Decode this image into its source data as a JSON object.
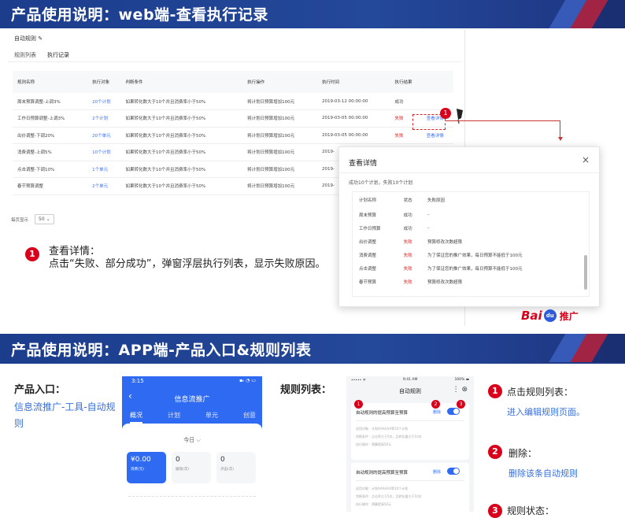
{
  "banner1": {
    "title": "产品使用说明：web端-查看执行记录"
  },
  "banner2": {
    "title": "产品使用说明：APP端-产品入口&规则列表"
  },
  "web": {
    "card_title": "自动规则",
    "tabs": [
      "规则列表",
      "执行记录"
    ],
    "columns": [
      "规则名称",
      "执行对象",
      "判断条件",
      "执行操作",
      "执行时间",
      "执行结果"
    ],
    "rows": [
      {
        "name": "周末预算调整-上调3%",
        "target": "20个计划",
        "cond": "如果转化数大于10个并且消费率小于50%",
        "op": "将计划日预算增加100元",
        "time": "2019-03-12 00:00:00",
        "result": "成功",
        "link": ""
      },
      {
        "name": "工作日预算调整-上调3%",
        "target": "2个计划",
        "cond": "如果转化数大于10个并且消费率小于50%",
        "op": "将计划日预算增加100元",
        "time": "2019-03-05 00:00:00",
        "result": "失败",
        "link": "查看详情"
      },
      {
        "name": "出价调整-下调20%",
        "target": "20个单元",
        "cond": "如果转化数大于10个并且消费率小于50%",
        "op": "将计划日预算增加100元",
        "time": "2019-03-05 00:00:00",
        "result": "失败",
        "link": "查看详情"
      },
      {
        "name": "消费调整-上调5%",
        "target": "10个计划",
        "cond": "如果转化数大于10个并且消费率小于50%",
        "op": "将计划日预算增加100元",
        "time": "2019-",
        "result": "",
        "link": ""
      },
      {
        "name": "点击调整-下调10%",
        "target": "1个单元",
        "cond": "如果转化数大于10个并且消费率小于50%",
        "op": "将计划日预算增加100元",
        "time": "2019-",
        "result": "",
        "link": ""
      },
      {
        "name": "春节预算调整",
        "target": "2个单元",
        "cond": "如果转化数大于10个并且消费率小于50%",
        "op": "将计划日预算增加100元",
        "time": "2019-",
        "result": "",
        "link": ""
      }
    ],
    "per_page_label": "每页显示",
    "per_page_value": "50"
  },
  "callout1": {
    "num": "1",
    "title": "查看详情：",
    "text": "点击“失败、部分成功”，弹窗浮层执行列表，显示失败原因。"
  },
  "marker1": "1",
  "modal": {
    "title": "查看详情",
    "close": "×",
    "summary": "成功10个计划，失败10个计划",
    "columns": [
      "计划名称",
      "状态",
      "失败原因"
    ],
    "rows": [
      {
        "name": "周末预算",
        "status": "成功",
        "reason": "–"
      },
      {
        "name": "工作日预算",
        "status": "成功",
        "reason": "–"
      },
      {
        "name": "出价调整",
        "status": "失败",
        "reason": "预算修改次数超限"
      },
      {
        "name": "消费调整",
        "status": "失败",
        "reason": "为了保证您的推广效果，每日预算不能低于100元"
      },
      {
        "name": "点击调整",
        "status": "失败",
        "reason": "为了保证您的推广效果，每日预算不能低于100元"
      },
      {
        "name": "春节预算",
        "status": "失败",
        "reason": "预算修改次数超限"
      }
    ]
  },
  "logo": {
    "text": "Bai",
    "paw": "du",
    "tag": "推广"
  },
  "entry": {
    "title": "产品入口：",
    "text": "信息流推广-工具-自动规则"
  },
  "phone1": {
    "time": "3:15",
    "status": "▪ᵢₗ ◔ ▭",
    "back": "‹",
    "title": "信息流推广",
    "tabs": [
      "概况",
      "计划",
      "单元",
      "创意"
    ],
    "date": "今日 ⌵",
    "stats": [
      {
        "value": "¥0.00",
        "label": "消费(元)"
      },
      {
        "value": "0",
        "label": "展现(次)"
      },
      {
        "value": "0",
        "label": "点击(次)"
      }
    ]
  },
  "rules": {
    "title": "规则列表："
  },
  "phone2": {
    "carrier": "••••• ᯤ",
    "time": "9:41 AM",
    "battery": "100% ▬",
    "title": "自动规则",
    "icons": "⋮  ⊗",
    "cards": [
      {
        "name": "自动规则的提高预算至预算",
        "del": "删除",
        "l1": "适用对象：计划AAAAAA等10个计划",
        "l2": "判断条件：点击率大于5次，且转化量大于10次",
        "l3": "执行操作：预算提高50元"
      },
      {
        "name": "自动规则的提高预算至预算",
        "del": "删除",
        "l1": "适用对象：计划AAAAAA等10个计划",
        "l2": "判断条件：点击率大于5次，且转化量大于10次",
        "l3": "执行操作：预算提高50元"
      }
    ],
    "markers": [
      "1",
      "2",
      "3"
    ]
  },
  "notes": [
    {
      "num": "1",
      "title": "点击规则列表：",
      "sub": "进入编辑规则页面。"
    },
    {
      "num": "2",
      "title": "删除：",
      "sub": "删除该条自动规则"
    },
    {
      "num": "3",
      "title": "规则状态：",
      "sub": ""
    }
  ]
}
